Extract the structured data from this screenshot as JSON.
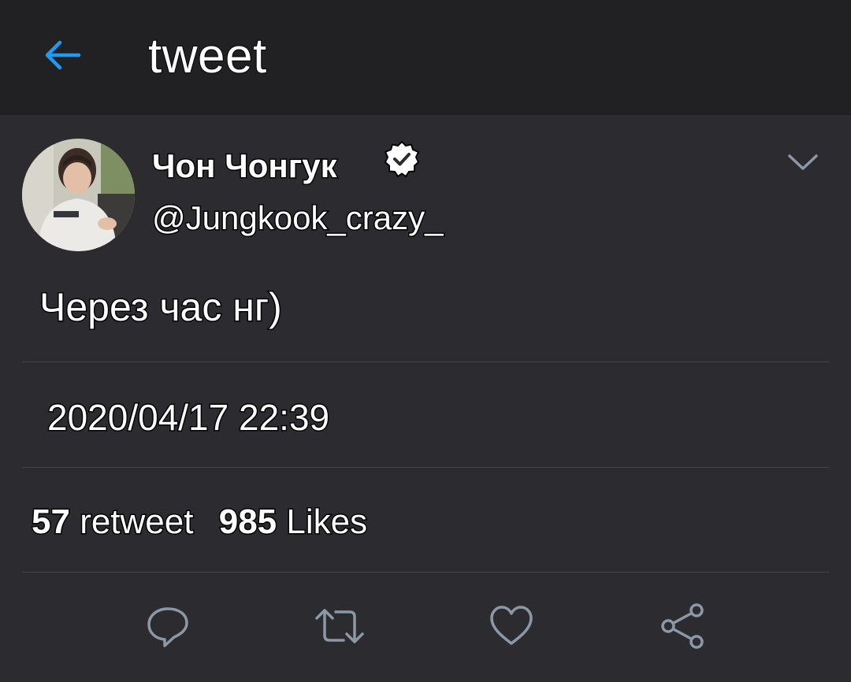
{
  "header": {
    "title": "tweet",
    "back_icon": "arrow-left-icon",
    "accent_color": "#1d9bf0"
  },
  "tweet": {
    "display_name": "Чон Чонгук",
    "handle": "@Jungkook_crazy_",
    "verified": true,
    "text": "Через час нг)",
    "timestamp": "2020/04/17 22:39",
    "retweet_count": "57",
    "retweet_label": "retweet",
    "like_count": "985",
    "like_label": "Likes"
  },
  "actions": [
    {
      "icon": "reply-icon"
    },
    {
      "icon": "retweet-icon"
    },
    {
      "icon": "like-icon"
    },
    {
      "icon": "share-icon"
    }
  ],
  "colors": {
    "background": "#2c2b30",
    "header_background": "#212023",
    "icon_color": "#8b98a5"
  }
}
